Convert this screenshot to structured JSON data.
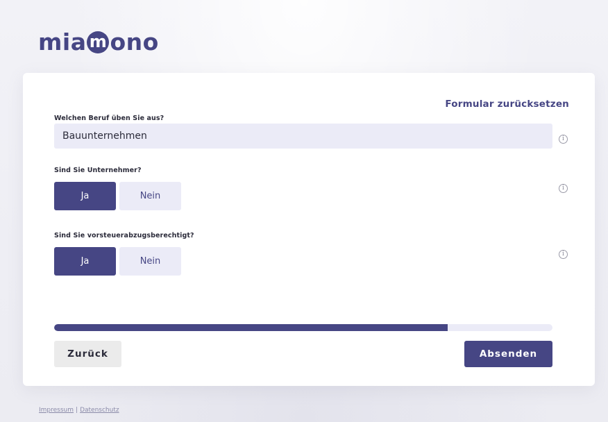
{
  "logo": {
    "before": "mia",
    "circle_letter": "m",
    "after": "ono"
  },
  "form": {
    "reset_link": "Formular zurücksetzen",
    "occupation": {
      "label": "Welchen Beruf üben Sie aus?",
      "value": "Bauunternehmen",
      "info_icon": "info-icon"
    },
    "entrepreneur": {
      "label": "Sind Sie Unternehmer?",
      "options": [
        "Ja",
        "Nein"
      ],
      "selected": "Ja",
      "info_icon": "info-icon"
    },
    "vat_deduction": {
      "label": "Sind Sie vorsteuerabzugsberechtigt?",
      "options": [
        "Ja",
        "Nein"
      ],
      "selected": "Ja",
      "info_icon": "info-icon"
    },
    "progress": 0.79,
    "back_label": "Zurück",
    "submit_label": "Absenden"
  },
  "footer": {
    "impressum": "Impressum",
    "separator": "|",
    "datenschutz": "Datenschutz"
  },
  "colors": {
    "brand": "#464684",
    "field_bg": "#ebebf7",
    "back_button_bg": "#ebebeb",
    "page_bg": "#f0f0f5"
  }
}
